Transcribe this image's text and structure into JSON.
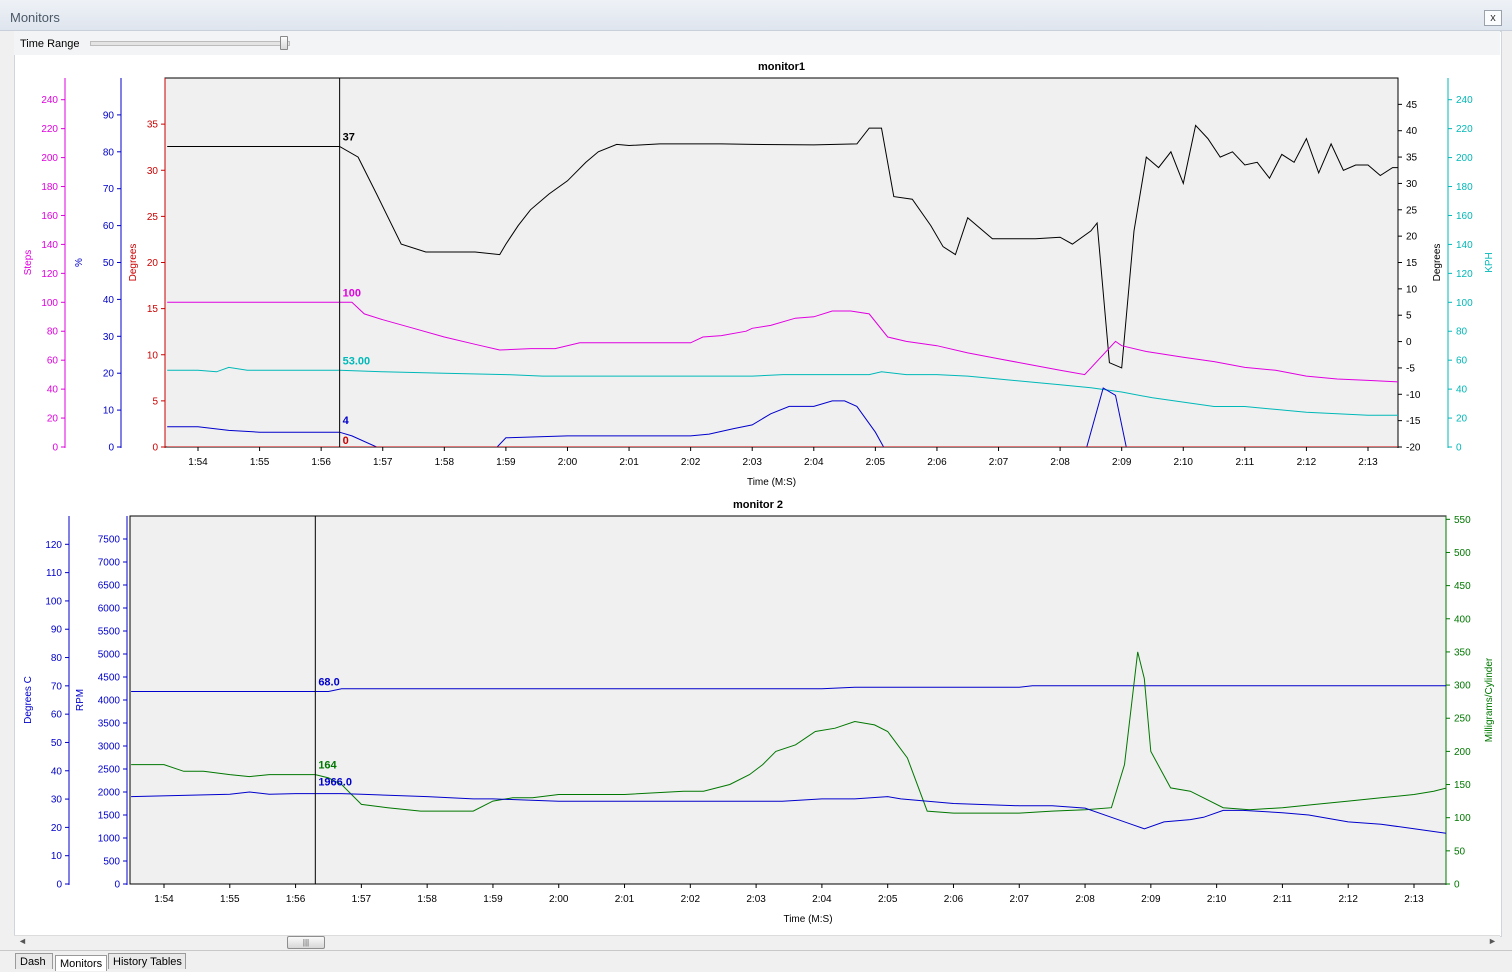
{
  "window": {
    "title": "Monitors",
    "close_glyph": "x"
  },
  "toolbar": {
    "time_range_label": "Time Range",
    "time_range_value": 0.98
  },
  "tabs": [
    {
      "label": "Dash",
      "active": false
    },
    {
      "label": "Monitors",
      "active": true
    },
    {
      "label": "History Tables",
      "active": false
    }
  ],
  "scrollbar": {
    "grip": "|||"
  },
  "cursor_time": "1:56.3",
  "chart_data": [
    {
      "type": "line",
      "title": "monitor1",
      "xlabel": "Time (M:S)",
      "xlim": [
        113.5,
        193.8
      ],
      "xticks": [
        {
          "v": 114,
          "label": "1:54"
        },
        {
          "v": 115,
          "label": "1:55"
        },
        {
          "v": 116,
          "label": "1:56"
        },
        {
          "v": 117,
          "label": "1:57"
        },
        {
          "v": 118,
          "label": "1:58"
        },
        {
          "v": 119,
          "label": "1:59"
        },
        {
          "v": 120,
          "label": "2:00"
        },
        {
          "v": 121,
          "label": "2:01"
        },
        {
          "v": 122,
          "label": "2:02"
        },
        {
          "v": 123,
          "label": "2:03"
        },
        {
          "v": 124,
          "label": "2:04"
        },
        {
          "v": 125,
          "label": "2:05"
        },
        {
          "v": 126,
          "label": "2:06"
        },
        {
          "v": 127,
          "label": "2:07"
        },
        {
          "v": 128,
          "label": "2:08"
        },
        {
          "v": 129,
          "label": "2:09"
        },
        {
          "v": 130,
          "label": "2:10"
        },
        {
          "v": 131,
          "label": "2:11"
        },
        {
          "v": 132,
          "label": "2:12"
        },
        {
          "v": 133,
          "label": "2:13"
        }
      ],
      "cursor_x": 116.3,
      "axes": [
        {
          "id": "steps",
          "side": "left",
          "label": "Steps",
          "color": "#e000e0",
          "min": 0,
          "max": 255,
          "ticks": [
            0,
            20,
            40,
            60,
            80,
            100,
            120,
            140,
            160,
            180,
            200,
            220,
            240
          ]
        },
        {
          "id": "pct",
          "side": "left",
          "label": "%",
          "color": "#0000cc",
          "min": 0,
          "max": 100,
          "ticks": [
            0,
            10,
            20,
            30,
            40,
            50,
            60,
            70,
            80,
            90
          ]
        },
        {
          "id": "deg1",
          "side": "left",
          "label": "Degrees",
          "color": "#cc0000",
          "min": 0,
          "max": 40,
          "ticks": [
            0,
            5,
            10,
            15,
            20,
            25,
            30,
            35
          ]
        },
        {
          "id": "deg2",
          "side": "right",
          "label": "Degrees",
          "color": "#000000",
          "min": -20,
          "max": 50,
          "ticks": [
            -20,
            -15,
            -10,
            -5,
            0,
            5,
            10,
            15,
            20,
            25,
            30,
            35,
            40,
            45
          ]
        },
        {
          "id": "kph",
          "side": "right",
          "label": "KPH",
          "color": "#00b8b8",
          "min": 0,
          "max": 255,
          "ticks": [
            0,
            20,
            40,
            60,
            80,
            100,
            120,
            140,
            160,
            180,
            200,
            220,
            240
          ]
        }
      ],
      "series": [
        {
          "axis": "deg2",
          "color": "#000000",
          "cursor_label": "37",
          "x": [
            113.5,
            116.3,
            116.6,
            116.9,
            117.3,
            117.7,
            118.0,
            118.5,
            118.9,
            119.0,
            119.2,
            119.4,
            119.7,
            120.0,
            120.3,
            120.5,
            120.8,
            121.0,
            121.5,
            122.0,
            122.5,
            123.0,
            124.0,
            124.7,
            124.9,
            125.1,
            125.3,
            125.6,
            125.9,
            126.1,
            126.3,
            126.5,
            126.9,
            127.3,
            127.6,
            128.0,
            128.2,
            128.5,
            128.6,
            128.8,
            129.0,
            129.2,
            129.4,
            129.6,
            129.8,
            130.0,
            130.2,
            130.4,
            130.6,
            130.8,
            131.0,
            131.2,
            131.4,
            131.6,
            131.8,
            132.0,
            132.2,
            132.4,
            132.6,
            132.8,
            133.0,
            133.2,
            133.4,
            133.6,
            133.8
          ],
          "y": [
            37,
            37,
            35,
            28,
            18.5,
            17,
            17,
            17,
            16.5,
            18.5,
            22,
            25,
            28,
            30.5,
            34,
            36,
            37.4,
            37.2,
            37.5,
            37.5,
            37.5,
            37.4,
            37.3,
            37.5,
            40.5,
            40.5,
            27.5,
            27,
            22,
            18,
            16.5,
            23.5,
            19.5,
            19.5,
            19.5,
            19.8,
            18.5,
            21,
            22.5,
            -4,
            -5,
            21,
            35,
            33,
            36,
            30,
            41,
            38.5,
            35,
            36,
            33.5,
            34,
            31,
            35.5,
            34,
            38.5,
            32,
            37.5,
            32.5,
            33.5,
            33.5,
            31.5,
            33,
            33,
            35.5
          ]
        },
        {
          "axis": "steps",
          "color": "#e000e0",
          "cursor_label": "100",
          "x": [
            113.5,
            116.3,
            116.5,
            116.7,
            117.0,
            117.5,
            118.0,
            118.5,
            118.9,
            119.4,
            119.8,
            120.2,
            121.0,
            121.5,
            122.0,
            122.2,
            122.5,
            122.9,
            123.0,
            123.3,
            123.7,
            124.0,
            124.3,
            124.6,
            124.9,
            125.2,
            125.5,
            126.0,
            126.5,
            127.0,
            127.5,
            128.0,
            128.4,
            128.9,
            129.0,
            129.4,
            130.0,
            130.5,
            131.0,
            131.5,
            132.0,
            132.5,
            133.0,
            133.5,
            133.8
          ],
          "y": [
            100,
            100,
            100,
            92,
            88,
            82,
            76,
            71,
            67,
            68,
            68,
            72,
            72,
            72,
            72,
            76,
            77,
            80,
            82,
            84,
            89,
            90,
            94,
            94,
            92,
            76,
            73,
            70,
            65,
            61,
            57,
            53,
            50,
            73,
            70,
            66,
            62,
            59,
            55,
            53,
            49,
            47,
            46,
            45,
            44
          ]
        },
        {
          "axis": "kph",
          "color": "#00b8b8",
          "cursor_label": "53.00",
          "x": [
            113.5,
            114.0,
            114.3,
            114.5,
            114.8,
            115.2,
            116.0,
            116.3,
            117.0,
            118.0,
            119.0,
            119.6,
            120.0,
            121.0,
            122.0,
            123.0,
            123.5,
            124.0,
            124.9,
            125.1,
            125.5,
            126.0,
            126.5,
            127.0,
            127.5,
            128.0,
            128.5,
            129.0,
            129.5,
            130.0,
            130.5,
            130.9,
            131.0,
            131.5,
            132.0,
            132.5,
            133.0,
            133.5,
            133.8
          ],
          "y": [
            53,
            53,
            52,
            55,
            53,
            53,
            53,
            53,
            52,
            51,
            50,
            49,
            49,
            49,
            49,
            49,
            50,
            50,
            50,
            52,
            50,
            50,
            49,
            47,
            45,
            43,
            41,
            38,
            34,
            31,
            28,
            28,
            28,
            26,
            24,
            23,
            22,
            22,
            20
          ]
        },
        {
          "axis": "pct",
          "color": "#0000cc",
          "cursor_label": "4",
          "x": [
            113.5,
            114.0,
            114.5,
            115.0,
            116.0,
            116.3,
            116.5,
            116.9,
            118.0,
            118.8,
            119.0,
            120.0,
            121.0,
            122.0,
            122.3,
            122.7,
            123.0,
            123.3,
            123.6,
            124.0,
            124.3,
            124.5,
            124.7,
            125.0,
            125.2,
            126.0,
            127.0,
            128.0,
            128.4,
            128.7,
            128.9,
            129.1,
            129.4,
            130.0,
            131.0,
            132.0,
            133.0,
            133.8
          ],
          "y": [
            5.5,
            5.5,
            4.5,
            4,
            4,
            4,
            3,
            0,
            -3,
            -1,
            2.5,
            3,
            3,
            3,
            3.5,
            5,
            6,
            9,
            11,
            11,
            12.5,
            12.5,
            11,
            4,
            -2,
            -8,
            -8,
            -8,
            -2,
            16,
            14,
            -2,
            -8,
            -8,
            -8,
            -8,
            -8,
            -8
          ]
        },
        {
          "axis": "deg1",
          "color": "#cc0000",
          "cursor_label": "0",
          "x": [
            113.5,
            133.8
          ],
          "y": [
            0,
            0
          ]
        }
      ]
    },
    {
      "type": "line",
      "title": "monitor 2",
      "xlabel": "Time (M:S)",
      "xlim": [
        113.5,
        193.6
      ],
      "xticks": [
        {
          "v": 114,
          "label": "1:54"
        },
        {
          "v": 115,
          "label": "1:55"
        },
        {
          "v": 116,
          "label": "1:56"
        },
        {
          "v": 117,
          "label": "1:57"
        },
        {
          "v": 118,
          "label": "1:58"
        },
        {
          "v": 119,
          "label": "1:59"
        },
        {
          "v": 120,
          "label": "2:00"
        },
        {
          "v": 121,
          "label": "2:01"
        },
        {
          "v": 122,
          "label": "2:02"
        },
        {
          "v": 123,
          "label": "2:03"
        },
        {
          "v": 124,
          "label": "2:04"
        },
        {
          "v": 125,
          "label": "2:05"
        },
        {
          "v": 126,
          "label": "2:06"
        },
        {
          "v": 127,
          "label": "2:07"
        },
        {
          "v": 128,
          "label": "2:08"
        },
        {
          "v": 129,
          "label": "2:09"
        },
        {
          "v": 130,
          "label": "2:10"
        },
        {
          "v": 131,
          "label": "2:11"
        },
        {
          "v": 132,
          "label": "2:12"
        },
        {
          "v": 133,
          "label": "2:13"
        }
      ],
      "cursor_x": 116.3,
      "axes": [
        {
          "id": "degc",
          "side": "left",
          "label": "Degrees C",
          "color": "#0000cc",
          "min": 0,
          "max": 130,
          "ticks": [
            0,
            10,
            20,
            30,
            40,
            50,
            60,
            70,
            80,
            90,
            100,
            110,
            120
          ]
        },
        {
          "id": "rpm",
          "side": "left",
          "label": "RPM",
          "color": "#0000cc",
          "min": 0,
          "max": 8000,
          "ticks": [
            0,
            500,
            1000,
            1500,
            2000,
            2500,
            3000,
            3500,
            4000,
            4500,
            5000,
            5500,
            6000,
            6500,
            7000,
            7500
          ]
        },
        {
          "id": "mgc",
          "side": "right",
          "label": "Milligrams/Cylinder",
          "color": "#007700",
          "min": 0,
          "max": 555,
          "ticks": [
            0,
            50,
            100,
            150,
            200,
            250,
            300,
            350,
            400,
            450,
            500,
            550
          ]
        }
      ],
      "series": [
        {
          "axis": "degc",
          "color": "#0000cc",
          "cursor_label": "68.0",
          "x": [
            113.5,
            116.3,
            116.5,
            116.7,
            120.0,
            124.0,
            124.5,
            127.0,
            127.2,
            130.0,
            133.5
          ],
          "y": [
            68,
            68,
            68,
            69,
            69,
            69,
            69.5,
            69.5,
            70,
            70,
            70
          ]
        },
        {
          "axis": "mgc",
          "color": "#007700",
          "cursor_label": "164",
          "x": [
            113.5,
            114.0,
            114.3,
            114.6,
            115.0,
            115.3,
            115.6,
            116.0,
            116.3,
            116.5,
            116.7,
            117.0,
            117.4,
            117.9,
            118.7,
            119.0,
            119.3,
            119.6,
            120.0,
            121.0,
            121.9,
            122.2,
            122.6,
            122.9,
            123.1,
            123.3,
            123.6,
            123.9,
            124.2,
            124.5,
            124.8,
            125.0,
            125.3,
            125.6,
            126.0,
            126.5,
            127.0,
            127.5,
            128.0,
            128.4,
            128.6,
            128.8,
            128.9,
            129.0,
            129.3,
            129.6,
            129.8,
            130.1,
            130.5,
            131.0,
            131.5,
            132.0,
            132.5,
            133.0,
            133.3,
            133.5
          ],
          "y": [
            180,
            180,
            170,
            170,
            165,
            162,
            165,
            165,
            165,
            160,
            150,
            120,
            115,
            110,
            110,
            125,
            130,
            130,
            135,
            135,
            140,
            140,
            150,
            165,
            180,
            200,
            210,
            230,
            235,
            245,
            240,
            230,
            190,
            110,
            107,
            107,
            107,
            110,
            112,
            115,
            180,
            350,
            310,
            200,
            145,
            140,
            130,
            115,
            112,
            115,
            120,
            125,
            130,
            135,
            140,
            145
          ]
        },
        {
          "axis": "rpm",
          "color": "#0000cc",
          "cursor_label": "1966.0",
          "x": [
            113.5,
            115.0,
            115.3,
            115.6,
            116.0,
            116.3,
            116.7,
            117.0,
            118.0,
            118.7,
            119.0,
            120.0,
            121.0,
            122.0,
            122.4,
            123.0,
            123.4,
            124.0,
            124.5,
            125.0,
            125.2,
            126.0,
            127.0,
            127.5,
            128.0,
            128.4,
            128.7,
            128.9,
            129.2,
            129.6,
            129.8,
            130.1,
            130.4,
            131.0,
            131.4,
            132.0,
            132.5,
            133.0,
            133.5
          ],
          "y": [
            1900,
            1950,
            2000,
            1950,
            1966,
            1966,
            1966,
            1950,
            1900,
            1850,
            1850,
            1800,
            1800,
            1800,
            1800,
            1800,
            1800,
            1850,
            1850,
            1900,
            1850,
            1750,
            1700,
            1700,
            1650,
            1450,
            1300,
            1200,
            1350,
            1400,
            1450,
            1600,
            1600,
            1550,
            1500,
            1350,
            1300,
            1200,
            1100
          ]
        }
      ]
    }
  ]
}
